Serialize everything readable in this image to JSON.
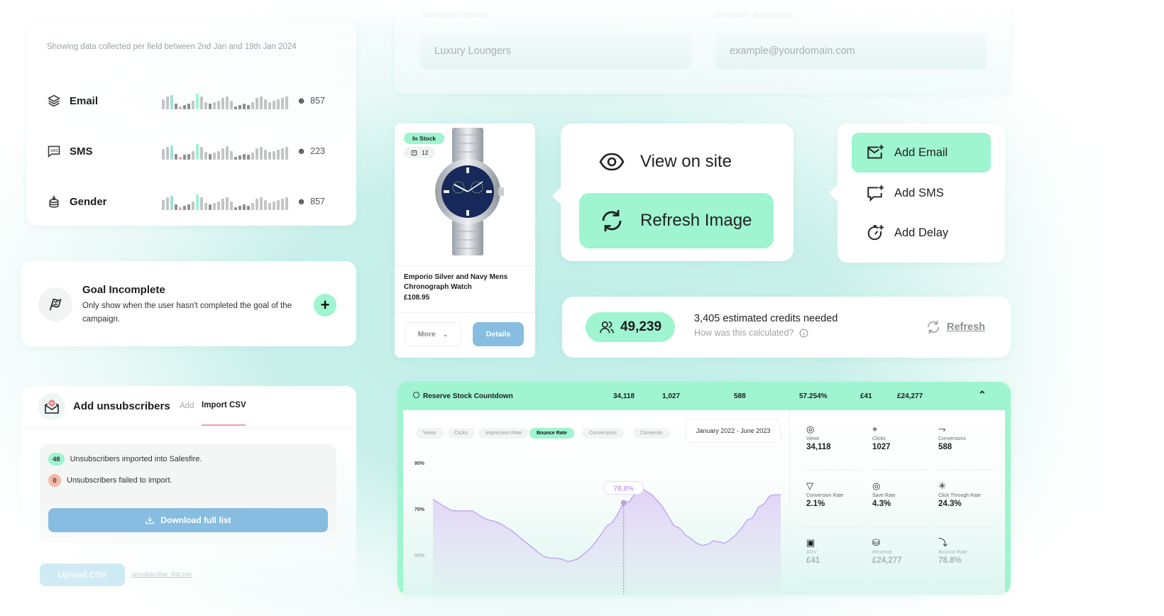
{
  "fields_panel": {
    "note": "Showing data collected per field between 2nd Jan and 19th Jan 2024",
    "rows": [
      {
        "icon": "layers-icon",
        "label": "Email",
        "count": "857"
      },
      {
        "icon": "sms-icon",
        "label": "SMS",
        "count": "223"
      },
      {
        "icon": "database-icon",
        "label": "Gender",
        "count": "857"
      }
    ]
  },
  "sender": {
    "name_label": "Sender name",
    "name_value": "Luxury Loungers",
    "address_label": "Sender address",
    "address_placeholder": "example@yourdomain.com"
  },
  "goal": {
    "icon": "flag-icon",
    "title": "Goal Incomplete",
    "description": "Only show when the user hasn't completed the goal of the campaign.",
    "add_icon": "plus-icon"
  },
  "unsubscribers": {
    "title": "Add unsubscribers",
    "tabs": [
      {
        "label": "Add",
        "active": false
      },
      {
        "label": "Import CSV",
        "active": true
      }
    ],
    "imported_count": "48",
    "imported_text": "Unsubscribers imported into Salesfire.",
    "failed_count": "0",
    "failed_text": "Unsubscribers failed to import.",
    "download_label": "Download full list",
    "upload_label": "Upload CSV",
    "file_name": "unsubscribe_list.csv"
  },
  "product": {
    "stock_badge": "In Stock",
    "quantity": "12",
    "name": "Emporio Silver and Navy Mens Chronograph Watch",
    "price": "£108.95",
    "more_label": "More",
    "details_label": "Details"
  },
  "image_menu": {
    "items": [
      {
        "icon": "eye-icon",
        "label": "View on site",
        "active": false
      },
      {
        "icon": "refresh-icon",
        "label": "Refresh Image",
        "active": true
      }
    ]
  },
  "add_menu": {
    "items": [
      {
        "icon": "mail-plus-icon",
        "label": "Add Email",
        "active": true
      },
      {
        "icon": "message-plus-icon",
        "label": "Add SMS",
        "active": false
      },
      {
        "icon": "timer-plus-icon",
        "label": "Add Delay",
        "active": false
      }
    ]
  },
  "credits": {
    "audience": "49,239",
    "estimate": "3,405 estimated credits needed",
    "help": "How was this calculated?",
    "refresh_label": "Refresh"
  },
  "analytics": {
    "campaign": "Reserve Stock Countdown",
    "summary": [
      "34,118",
      "1,027",
      "588",
      "57.254%",
      "£41",
      "£24,277"
    ],
    "chips": [
      {
        "label": "Views",
        "active": false
      },
      {
        "label": "Clicks",
        "active": false
      },
      {
        "label": "Impression Rate",
        "active": false
      },
      {
        "label": "Bounce Rate",
        "active": true
      },
      {
        "label": "Conversions",
        "active": false
      },
      {
        "label": "Conversio",
        "active": false
      }
    ],
    "date_range": "January 2022 - June 2023",
    "tooltip": "78.8%",
    "stats": [
      {
        "icon": "eye-icon",
        "label": "Views",
        "value": "34,118"
      },
      {
        "icon": "click-icon",
        "label": "Clicks",
        "value": "1027"
      },
      {
        "icon": "chart-icon",
        "label": "Conversions",
        "value": "588"
      },
      {
        "icon": "filter-icon",
        "label": "Conversion Rate",
        "value": "2.1%"
      },
      {
        "icon": "lifebuoy-icon",
        "label": "Save Rate",
        "value": "4.3%"
      },
      {
        "icon": "cursor-click-icon",
        "label": "Click Through Rate",
        "value": "24.3%"
      },
      {
        "icon": "bag-icon",
        "label": "AOV",
        "value": "£41"
      },
      {
        "icon": "coins-icon",
        "label": "Revenue",
        "value": "£24,277"
      },
      {
        "icon": "bounce-icon",
        "label": "Bounce Rate",
        "value": "78.8%"
      }
    ]
  },
  "chart_data": {
    "type": "area",
    "title": "Bounce Rate",
    "xlabel": "",
    "ylabel": "",
    "y_ticks": [
      "90%",
      "70%",
      "50%"
    ],
    "ylim": [
      40,
      95
    ],
    "grid": false,
    "highlight": {
      "index": 34,
      "label": "78.8%"
    },
    "values": [
      73.5,
      72,
      70.5,
      69,
      68.5,
      68.5,
      68.5,
      68.5,
      67,
      65.5,
      64.5,
      64,
      63,
      61.5,
      60,
      58,
      56,
      54,
      52,
      50,
      48.5,
      48,
      48,
      47.5,
      46.5,
      47,
      48,
      50,
      52,
      55,
      58.5,
      62,
      63.5,
      67.5,
      72,
      72.5,
      76,
      78.8,
      77,
      75.5,
      73,
      70,
      66,
      62,
      61,
      58,
      56.5,
      54.5,
      53.5,
      54,
      55.5,
      55,
      54.5,
      56,
      58,
      61,
      64.5,
      65.5,
      70,
      71.5,
      75,
      75.5,
      75.5
    ]
  }
}
